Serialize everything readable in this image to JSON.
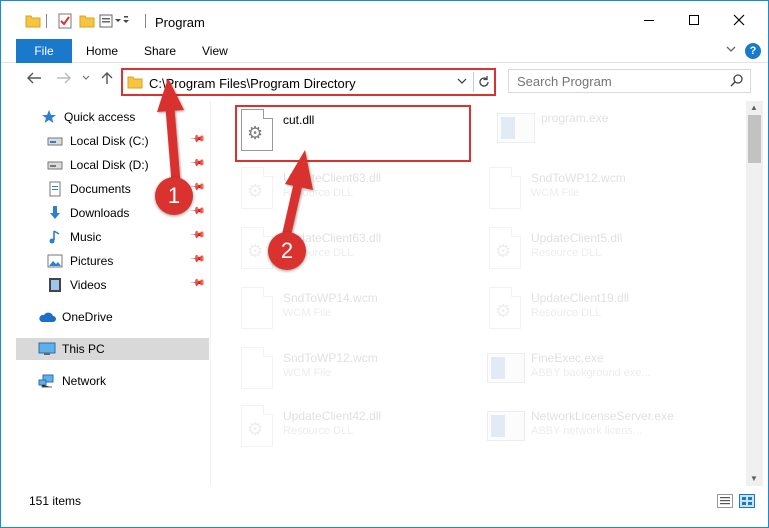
{
  "titlebar": {
    "title": "Program",
    "quick_access_icons": [
      "folder-icon",
      "properties-check-icon",
      "new-folder-icon",
      "customize-qat-icon"
    ],
    "controls": [
      "minimize",
      "maximize",
      "close"
    ]
  },
  "ribbon": {
    "tabs": [
      {
        "label": "File",
        "active": true
      },
      {
        "label": "Home"
      },
      {
        "label": "Share"
      },
      {
        "label": "View"
      }
    ],
    "help_label": "?"
  },
  "address": {
    "path": "C:\\Program Files\\Program Directory",
    "search_placeholder": "Search Program"
  },
  "sidebar": {
    "items": [
      {
        "label": "Quick access",
        "icon": "star-icon",
        "pinned": false
      },
      {
        "label": "Local Disk (C:)",
        "icon": "drive-icon",
        "pinned": true
      },
      {
        "label": "Local Disk (D:)",
        "icon": "drive-icon",
        "pinned": true
      },
      {
        "label": "Documents",
        "icon": "documents-icon",
        "pinned": true
      },
      {
        "label": "Downloads",
        "icon": "download-icon",
        "pinned": true
      },
      {
        "label": "Music",
        "icon": "music-icon",
        "pinned": true
      },
      {
        "label": "Pictures",
        "icon": "pictures-icon",
        "pinned": true
      },
      {
        "label": "Videos",
        "icon": "videos-icon",
        "pinned": true
      },
      {
        "label": "OneDrive",
        "icon": "cloud-icon",
        "pinned": false
      },
      {
        "label": "This PC",
        "icon": "computer-icon",
        "pinned": false,
        "selected": true
      },
      {
        "label": "Network",
        "icon": "network-icon",
        "pinned": false
      }
    ]
  },
  "files": [
    {
      "name": "cut.dll",
      "type": "",
      "icon": "dll-icon",
      "highlighted": true
    },
    {
      "name": "program.exe",
      "type": "",
      "icon": "exe-icon"
    },
    {
      "name": "UpdateClient63.dll",
      "type": "Resource DLL",
      "icon": "dll-icon"
    },
    {
      "name": "SndToWP12.wcm",
      "type": "WCM File",
      "icon": "file-icon"
    },
    {
      "name": "UpdateClient63.dll",
      "type": "Resource DLL",
      "icon": "dll-icon"
    },
    {
      "name": "UpdateClient5.dll",
      "type": "Resource DLL",
      "icon": "file-icon"
    },
    {
      "name": "SndToWP14.wcm",
      "type": "WCM File",
      "icon": "file-icon"
    },
    {
      "name": "UpdateClient19.dll",
      "type": "Resource DLL",
      "icon": "dll-icon"
    },
    {
      "name": "SndToWP12.wcm",
      "type": "WCM File",
      "icon": "file-icon"
    },
    {
      "name": "FineExec.exe",
      "type": "ABBY background exe...",
      "icon": "exe-icon"
    },
    {
      "name": "UpdateClient42.dll",
      "type": "Resource DLL",
      "icon": "dll-icon"
    },
    {
      "name": "NetworkLicenseServer.exe",
      "type": "ABBY network licens...",
      "icon": "exe-icon"
    }
  ],
  "status": {
    "item_count": "151 items"
  },
  "annotations": [
    {
      "label": "1",
      "color": "#d9322f"
    },
    {
      "label": "2",
      "color": "#d9322f"
    }
  ],
  "colors": {
    "accent": "#1979ca",
    "highlight_red": "#d9322f",
    "selected_bg": "#d9d9d9"
  }
}
